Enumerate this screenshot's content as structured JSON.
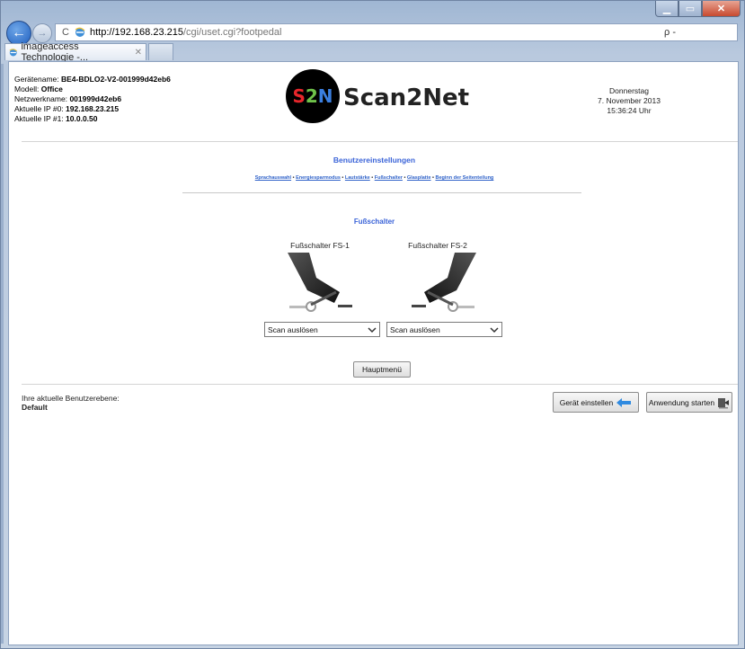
{
  "browser": {
    "url_host": "http://192.168.23.215",
    "url_path": "/cgi/uset.cgi?footpedal",
    "search_label": "ρ -",
    "tab_title": "imageaccess Technologie -...",
    "tab_close": "✕"
  },
  "device": {
    "name_label": "Gerätename:",
    "name_value": "BE4-BDLO2-V2-001999d42eb6",
    "model_label": "Modell:",
    "model_value": "Office",
    "netname_label": "Netzwerkname:",
    "netname_value": "001999d42eb6",
    "ip0_label": "Aktuelle IP #0:",
    "ip0_value": "192.168.23.215",
    "ip1_label": "Aktuelle IP #1:",
    "ip1_value": "10.0.0.50"
  },
  "logo": {
    "mark": "S2N",
    "wordmark": "Scan2Net"
  },
  "date": {
    "weekday": "Donnerstag",
    "date": "7. November 2013",
    "time": "15:36:24 Uhr"
  },
  "section": {
    "title": "Benutzereinstellungen",
    "links": [
      "Sprachauswahl",
      "Energiesparmodus",
      "Lautstärke",
      "Fußschalter",
      "Glasplatte",
      "Beginn der Seitenteilung"
    ],
    "separator": "•"
  },
  "footpedal": {
    "title": "Fußschalter",
    "fs1_label": "Fußschalter FS-1",
    "fs2_label": "Fußschalter FS-2",
    "fs1_value": "Scan auslösen",
    "fs2_value": "Scan auslösen"
  },
  "buttons": {
    "main_menu": "Hauptmenü",
    "device_setup": "Gerät einstellen",
    "start_app": "Anwendung starten"
  },
  "user": {
    "level_label": "Ihre aktuelle Benutzerebene:",
    "level_value": "Default"
  },
  "colors": {
    "accent": "#3a63d8",
    "link": "#2f62c9"
  }
}
